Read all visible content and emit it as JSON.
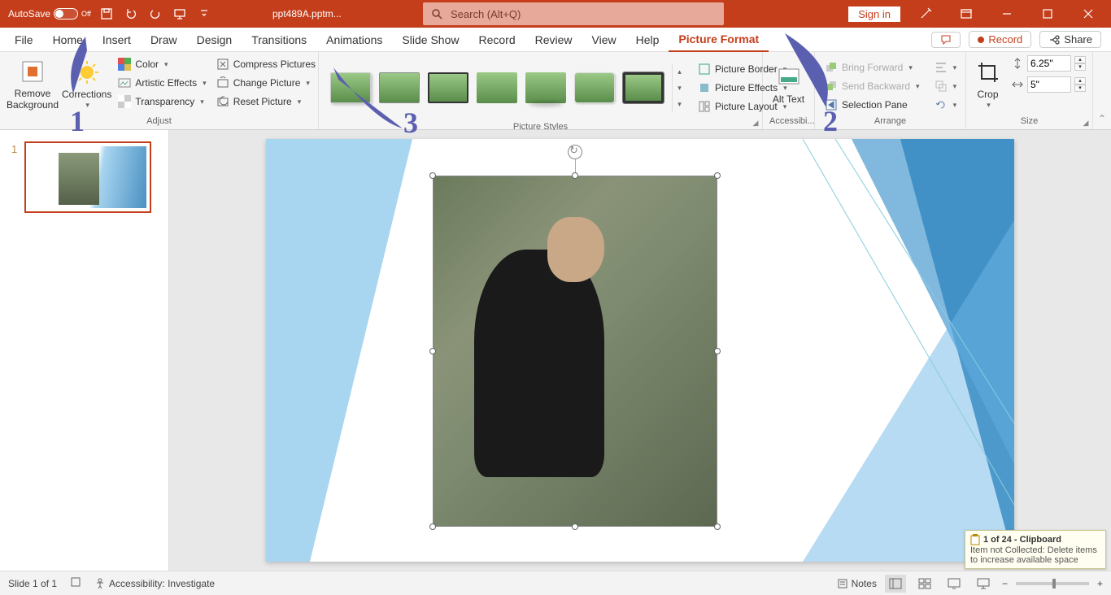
{
  "titlebar": {
    "autosave_label": "AutoSave",
    "autosave_state": "Off",
    "filename": "ppt489A.pptm...",
    "search_placeholder": "Search (Alt+Q)",
    "signin": "Sign in"
  },
  "tabs": {
    "file": "File",
    "home": "Home",
    "insert": "Insert",
    "draw": "Draw",
    "design": "Design",
    "transitions": "Transitions",
    "animations": "Animations",
    "slideshow": "Slide Show",
    "record": "Record",
    "review": "Review",
    "view": "View",
    "help": "Help",
    "picture_format": "Picture Format",
    "record_btn": "Record",
    "share_btn": "Share"
  },
  "ribbon": {
    "adjust": {
      "remove_bg": "Remove Background",
      "corrections": "Corrections",
      "color": "Color",
      "artistic": "Artistic Effects",
      "transparency": "Transparency",
      "compress": "Compress Pictures",
      "change": "Change Picture",
      "reset": "Reset Picture",
      "label": "Adjust"
    },
    "styles": {
      "label": "Picture Styles",
      "border": "Picture Border",
      "effects": "Picture Effects",
      "layout": "Picture Layout"
    },
    "accessibility": {
      "alt": "Alt Text",
      "label": "Accessibi..."
    },
    "arrange": {
      "forward": "Bring Forward",
      "backward": "Send Backward",
      "selpane": "Selection Pane",
      "label": "Arrange"
    },
    "size": {
      "crop": "Crop",
      "height": "6.25\"",
      "width": "5\"",
      "label": "Size"
    }
  },
  "annotations": {
    "n1": "1",
    "n2": "2",
    "n3": "3"
  },
  "status": {
    "slide": "Slide 1 of 1",
    "accessibility": "Accessibility: Investigate",
    "notes": "Notes"
  },
  "clipboard": {
    "title": "1 of 24 - Clipboard",
    "msg": "Item not Collected: Delete items to increase available space"
  },
  "thumb": {
    "num": "1"
  }
}
